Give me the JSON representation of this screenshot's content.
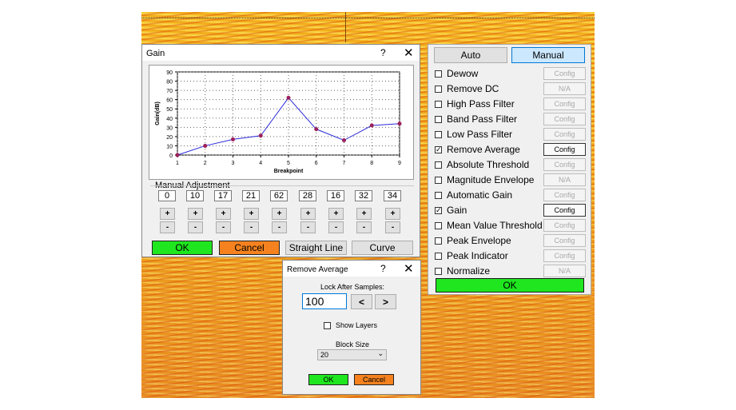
{
  "gain_dialog": {
    "title": "Gain",
    "help": "?",
    "close": "✕",
    "manual_label": "Manual Adjustment",
    "plus": "+",
    "minus": "-",
    "ok": "OK",
    "cancel": "Cancel",
    "straight_line": "Straight Line",
    "curve": "Curve",
    "values": [
      "0",
      "10",
      "17",
      "21",
      "62",
      "28",
      "16",
      "32",
      "34"
    ]
  },
  "chart_data": {
    "type": "line",
    "x": [
      1,
      2,
      3,
      4,
      5,
      6,
      7,
      8,
      9
    ],
    "values": [
      0,
      10,
      17,
      21,
      62,
      28,
      16,
      32,
      34
    ],
    "xlabel": "Breakpoint",
    "ylabel": "Gain(dB)",
    "xlim": [
      1,
      9
    ],
    "ylim": [
      0,
      90
    ],
    "yticks": [
      0,
      10,
      20,
      30,
      40,
      50,
      60,
      70,
      80,
      90
    ],
    "xticks": [
      1,
      2,
      3,
      4,
      5,
      6,
      7,
      8,
      9
    ],
    "grid": true,
    "line_color": "#2b2bd9",
    "marker_color": "#9c1f5b"
  },
  "filter_panel": {
    "auto": "Auto",
    "manual": "Manual",
    "ok": "OK",
    "items": [
      {
        "label": "Dewow",
        "checked": false,
        "config": "Config",
        "active": false
      },
      {
        "label": "Remove DC",
        "checked": false,
        "config": "N/A",
        "active": false
      },
      {
        "label": "High Pass Filter",
        "checked": false,
        "config": "Config",
        "active": false
      },
      {
        "label": "Band Pass Filter",
        "checked": false,
        "config": "Config",
        "active": false
      },
      {
        "label": "Low Pass Filter",
        "checked": false,
        "config": "Config",
        "active": false
      },
      {
        "label": "Remove Average",
        "checked": true,
        "config": "Config",
        "active": true
      },
      {
        "label": "Absolute Threshold",
        "checked": false,
        "config": "Config",
        "active": false
      },
      {
        "label": "Magnitude Envelope",
        "checked": false,
        "config": "N/A",
        "active": false
      },
      {
        "label": "Automatic Gain",
        "checked": false,
        "config": "Config",
        "active": false
      },
      {
        "label": "Gain",
        "checked": true,
        "config": "Config",
        "active": true
      },
      {
        "label": "Mean Value Threshold",
        "checked": false,
        "config": "Config",
        "active": false
      },
      {
        "label": "Peak Envelope",
        "checked": false,
        "config": "Config",
        "active": false
      },
      {
        "label": "Peak Indicator",
        "checked": false,
        "config": "Config",
        "active": false
      },
      {
        "label": "Normalize",
        "checked": false,
        "config": "N/A",
        "active": false
      }
    ]
  },
  "remove_avg": {
    "title": "Remove Average",
    "help": "?",
    "close": "✕",
    "lock_label": "Lock After Samples:",
    "lock_value": "100",
    "prev": "<",
    "next": ">",
    "show_layers": "Show Layers",
    "block_label": "Block Size",
    "block_value": "20",
    "ok": "OK",
    "cancel": "Cancel"
  },
  "colors": {
    "ok_green": "#1fe61f",
    "cancel_orange": "#f5821f",
    "manual_blue": "#cce8ff"
  }
}
